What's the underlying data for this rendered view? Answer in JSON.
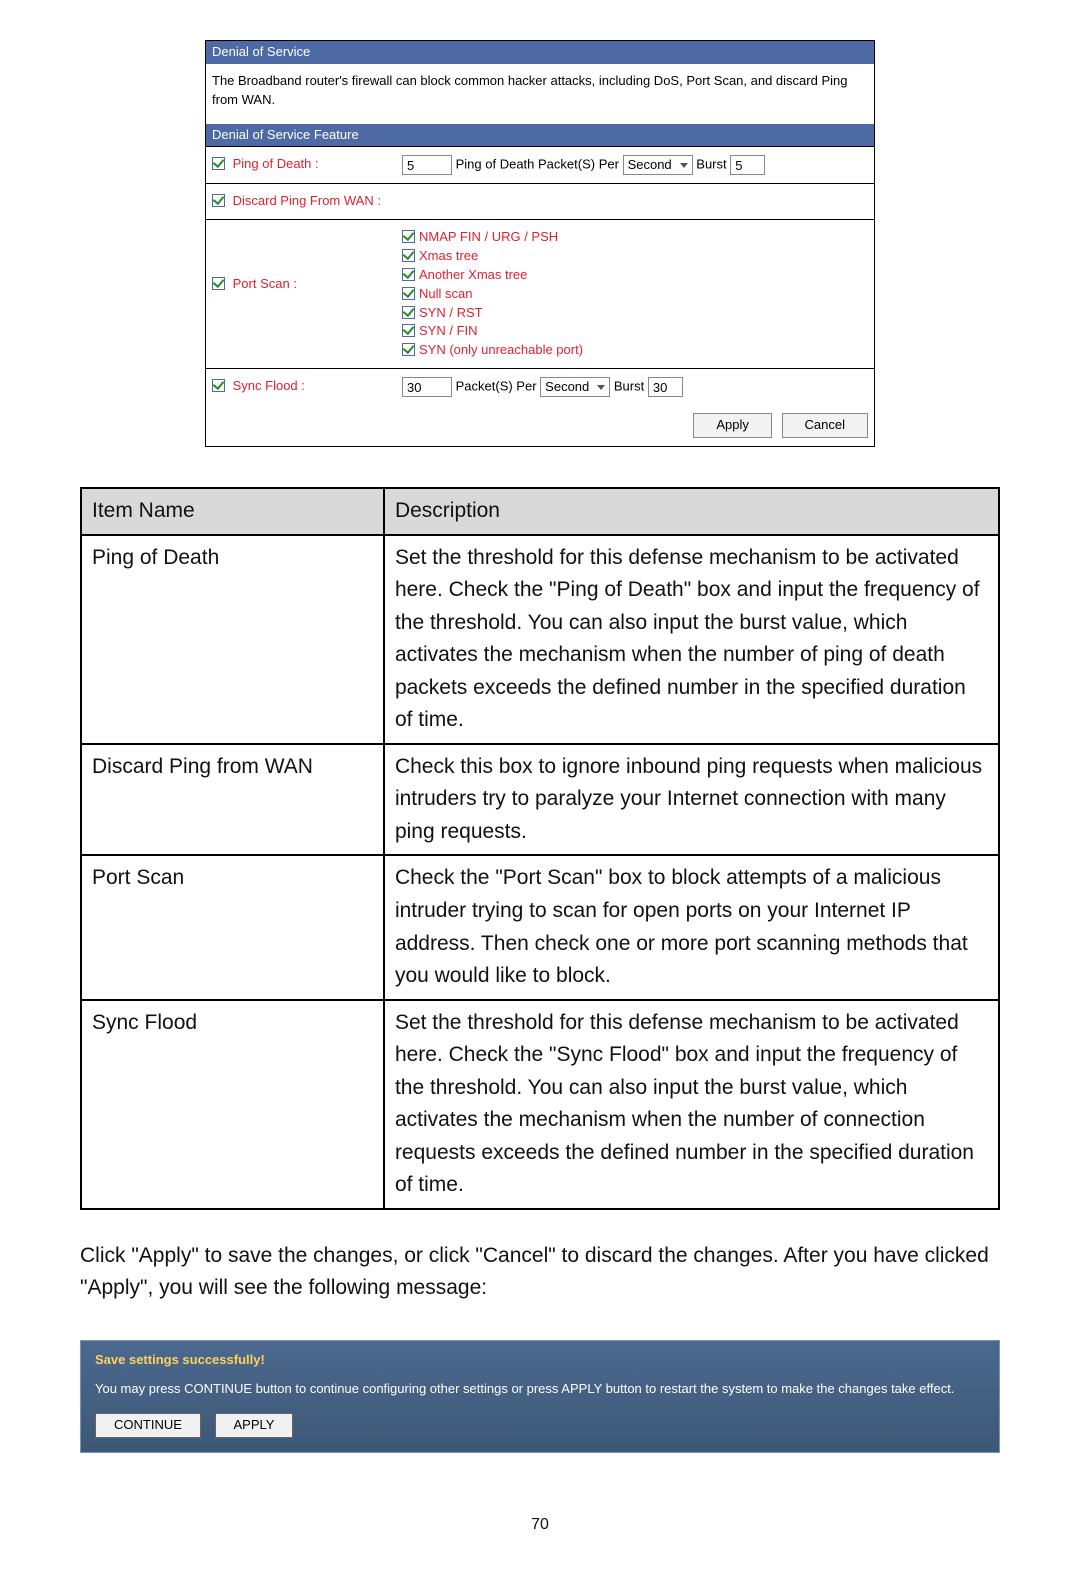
{
  "dos": {
    "header1": "Denial of Service",
    "intro": "The Broadband router's firewall can block common hacker attacks, including DoS, Port Scan, and discard Ping from WAN.",
    "header2": "Denial of Service Feature",
    "ping_label": "Ping of Death :",
    "ping_count": "5",
    "ping_text1": "Ping of Death Packet(S) Per",
    "ping_unit": "Second",
    "ping_burst_label": "Burst",
    "ping_burst_val": "5",
    "discard_label": "Discard Ping From WAN :",
    "portscan_label": "Port Scan :",
    "ps_items": {
      "nmap": "NMAP FIN / URG / PSH",
      "xmas": "Xmas tree",
      "axmas": "Another Xmas tree",
      "null": "Null scan",
      "synrst": "SYN / RST",
      "synfin": "SYN / FIN",
      "synonly": "SYN (only unreachable port)"
    },
    "sync_label": "Sync Flood :",
    "sync_count": "30",
    "sync_text1": "Packet(S) Per",
    "sync_unit": "Second",
    "sync_burst_label": "Burst",
    "sync_burst_val": "30",
    "apply": "Apply",
    "cancel": "Cancel"
  },
  "table": {
    "h1": "Item Name",
    "h2": "Description",
    "rows": [
      {
        "name": "Ping of Death",
        "desc": "Set the threshold for this defense mechanism to be activated here. Check the \"Ping of Death\" box and input the frequency of the threshold. You can also input the burst value, which activates the mechanism when the number of ping of death packets exceeds the defined number in the specified duration of time."
      },
      {
        "name": "Discard Ping from WAN",
        "desc": "Check this box to ignore inbound ping requests when malicious intruders try to paralyze your Internet connection with many ping requests."
      },
      {
        "name": "Port Scan",
        "desc": "Check the \"Port Scan\" box to block attempts of a malicious intruder trying to scan for open ports on your Internet IP address. Then check one or more port scanning methods that you would like to block."
      },
      {
        "name": "Sync Flood",
        "desc": "Set the threshold for this defense mechanism to be activated here. Check the \"Sync Flood\" box and input the frequency of the threshold. You can also input the burst value, which activates the mechanism when the number of connection requests exceeds the defined number in the specified duration of time."
      }
    ]
  },
  "body_text": "Click \"Apply\" to save the changes, or click \"Cancel\" to discard the changes. After you have clicked \"Apply\", you will see the following message:",
  "save": {
    "title": "Save settings successfully!",
    "text": "You may press CONTINUE button to continue configuring other settings or press APPLY button to restart the system to make the changes take effect.",
    "continue": "CONTINUE",
    "apply": "APPLY"
  },
  "page_no": "70"
}
